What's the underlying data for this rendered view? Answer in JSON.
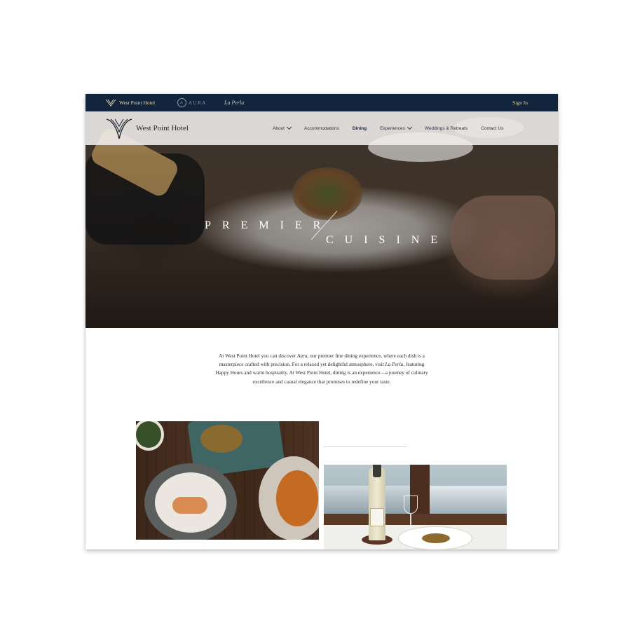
{
  "brandbar": {
    "brands": [
      {
        "label": "West Point Hotel"
      },
      {
        "label": "AURA",
        "mark": "A"
      },
      {
        "label": "La Perla"
      }
    ],
    "sign_in": "Sign In"
  },
  "nav": {
    "logo_text": "West Point Hotel",
    "links": [
      {
        "label": "About",
        "dropdown": true
      },
      {
        "label": "Accommodations"
      },
      {
        "label": "Dining",
        "active": true
      },
      {
        "label": "Experiences",
        "dropdown": true
      },
      {
        "label": "Weddings & Retreats"
      },
      {
        "label": "Contact Us"
      }
    ]
  },
  "hero": {
    "word1": "PREMIER",
    "word2": "CUISINE"
  },
  "intro": {
    "part1": "At West Point Hotel you can discover ",
    "aura": "Aura",
    "part2": ", our premier fine dining experience, where each dish is a masterpiece crafted with precision. For a relaxed yet delightful atmosphere, visit ",
    "laperla": "La Perla",
    "part3": ", featuring Happy Hours and warm hospitality. At West Point Hotel, dining is an experience—a journey of culinary excellence and casual elegance that promises to redefine your taste."
  },
  "colors": {
    "brandbar_bg": "#13253c",
    "gold": "#d9cfa8",
    "nav_bg": "#f0eeec",
    "text_dark": "#1c2430"
  },
  "icons": {
    "logo": "west-point-emblem-icon",
    "dropdown": "chevron-down-icon"
  }
}
